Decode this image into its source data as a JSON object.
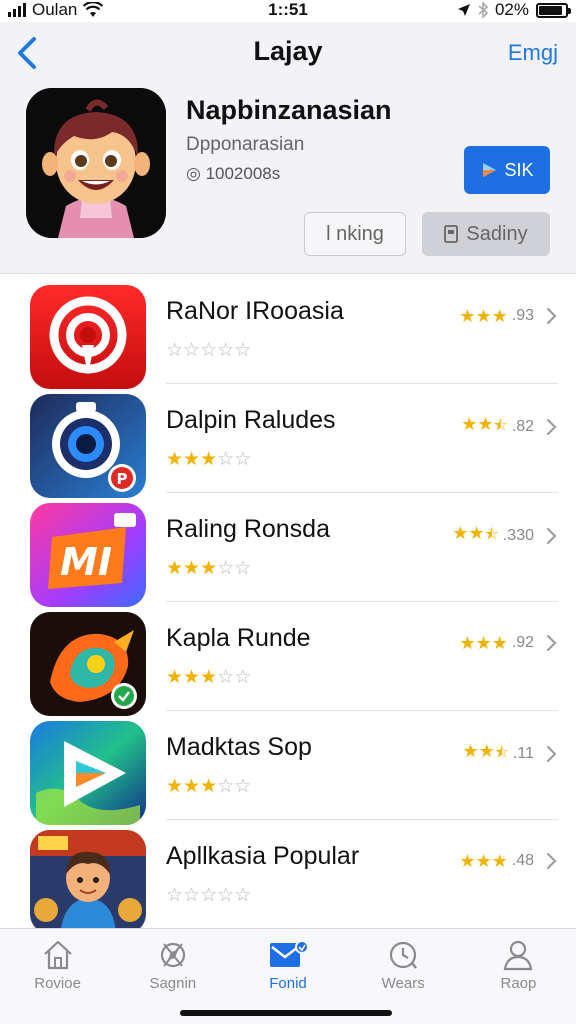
{
  "status_bar": {
    "carrier": "Oulan",
    "time": "1::51",
    "battery_text": "02%",
    "battery_level": 0.9
  },
  "nav": {
    "title": "Lajay",
    "right_label": "Emgj"
  },
  "featured": {
    "title": "Napbinzanasian",
    "subtitle": "Dpponarasian",
    "count": "1002008s",
    "get_label": "SIK",
    "outline_label": "l nking",
    "gray_label": "Sadiny"
  },
  "apps": [
    {
      "name": "RaNor IRooasia",
      "stars": 0,
      "right_stars": 3,
      "score": ".93",
      "icon": "red-target-icon"
    },
    {
      "name": "Dalpin Raludes",
      "stars": 3,
      "right_stars": 2.5,
      "score": ".82",
      "icon": "camera-lens-icon"
    },
    {
      "name": "Raling Ronsda",
      "stars": 3,
      "right_stars": 2.5,
      "score": ".330",
      "icon": "mi-logo-icon"
    },
    {
      "name": "Kapla Runde",
      "stars": 3,
      "right_stars": 3,
      "score": ".92",
      "icon": "colorful-bird-icon"
    },
    {
      "name": "Madktas Sop",
      "stars": 3,
      "right_stars": 2.5,
      "score": ".11",
      "icon": "play-triangle-icon"
    },
    {
      "name": "Apllkasia Popular",
      "stars": 0,
      "right_stars": 3,
      "score": ".48",
      "icon": "cartoon-boy-icon"
    }
  ],
  "tabs": [
    {
      "label": "Rovioe",
      "icon": "home-icon",
      "active": false
    },
    {
      "label": "Sagnin",
      "icon": "compass-icon",
      "active": false
    },
    {
      "label": "Fonid",
      "icon": "mail-icon",
      "active": true
    },
    {
      "label": "Wears",
      "icon": "clock-icon",
      "active": false
    },
    {
      "label": "Raop",
      "icon": "person-icon",
      "active": false
    }
  ],
  "colors": {
    "accent": "#1e6fe3",
    "star": "#f2b200"
  }
}
